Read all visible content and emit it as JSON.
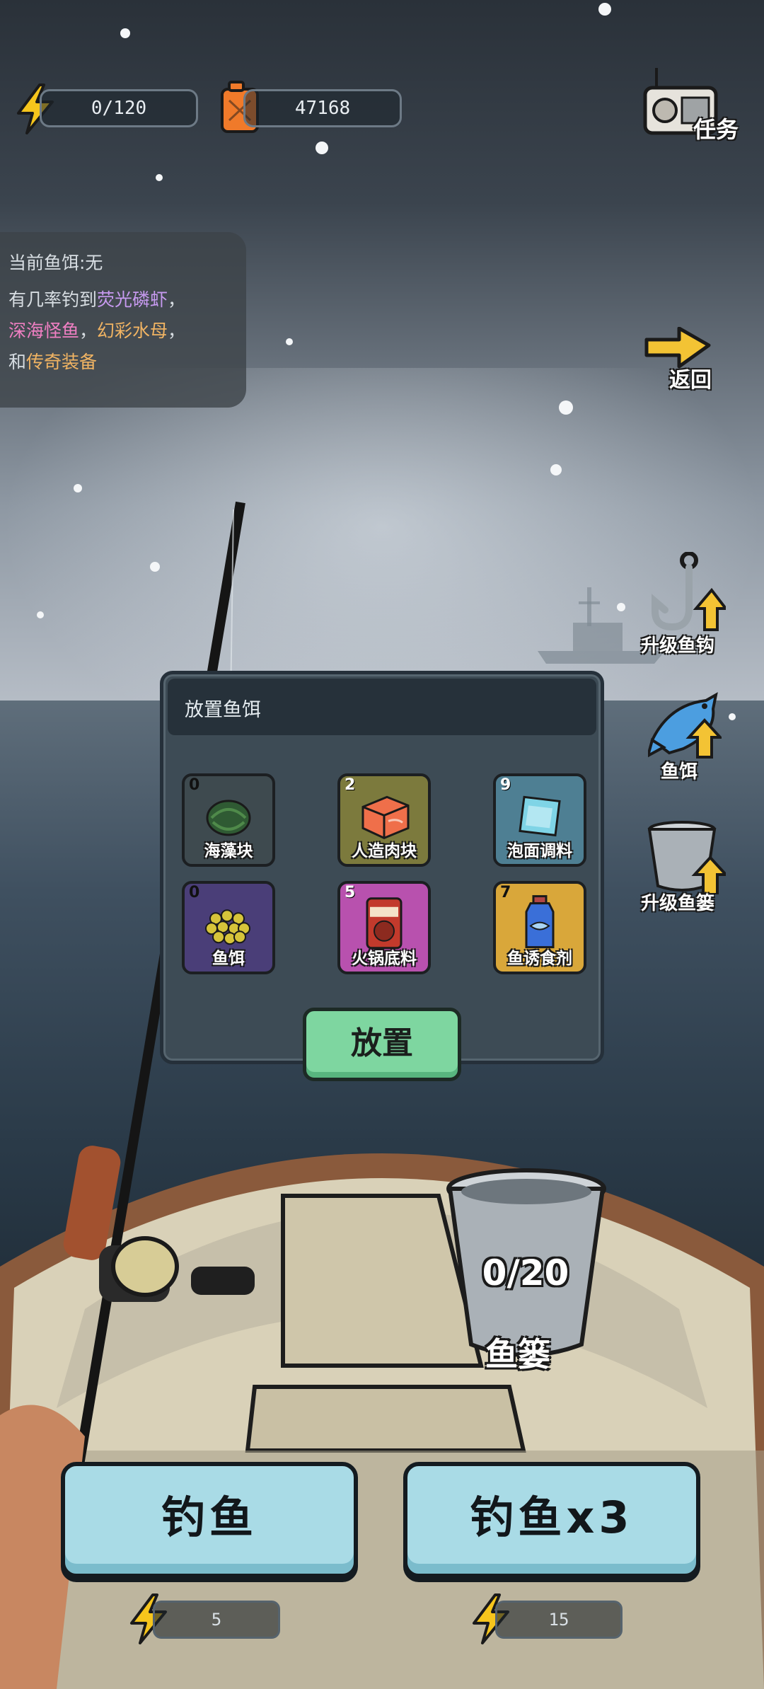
{
  "top_bar": {
    "energy_value": "0/120",
    "fuel_value": "47168",
    "task_label": "任务"
  },
  "bait_info": {
    "current_bait": "当前鱼饵:无",
    "line_1": "有几率钓到",
    "highlight_1": "荧光磷虾",
    "sep_1": "，",
    "highlight_2": "深海怪鱼",
    "sep_2": "，",
    "highlight_3": "幻彩水母",
    "sep_3": "，",
    "line_3_prefix": "和",
    "highlight_4": "传奇装备"
  },
  "side_menu": {
    "back_label": "返回",
    "upgrade_hook_label": "升级鱼钩",
    "bait_label": "鱼饵",
    "upgrade_basket_label": "升级鱼篓"
  },
  "bait_dialog": {
    "title": "放置鱼饵",
    "items": [
      {
        "name": "海藻块",
        "count": "0",
        "bg": "#3e4a4f"
      },
      {
        "name": "人造肉块",
        "count": "2",
        "bg": "#7c7a3d"
      },
      {
        "name": "泡面调料",
        "count": "9",
        "bg": "#4e7f93"
      },
      {
        "name": "鱼饵",
        "count": "0",
        "bg": "#4a3e78"
      },
      {
        "name": "火锅底料",
        "count": "5",
        "bg": "#b851ae"
      },
      {
        "name": "鱼诱食剂",
        "count": "7",
        "bg": "#d9a73a"
      }
    ],
    "place_button": "放置"
  },
  "boat": {
    "bucket_count": "0/20",
    "bucket_label": "鱼篓"
  },
  "actions": {
    "fish_label": "钓鱼",
    "fish_cost": "5",
    "fish3_label": "钓鱼x3",
    "fish3_cost": "15"
  },
  "colors": {
    "energy": "#f6c51c",
    "fuel": "#f07a2a",
    "place_button": "#7ed6a0",
    "fish_button": "#a9dbe6"
  }
}
